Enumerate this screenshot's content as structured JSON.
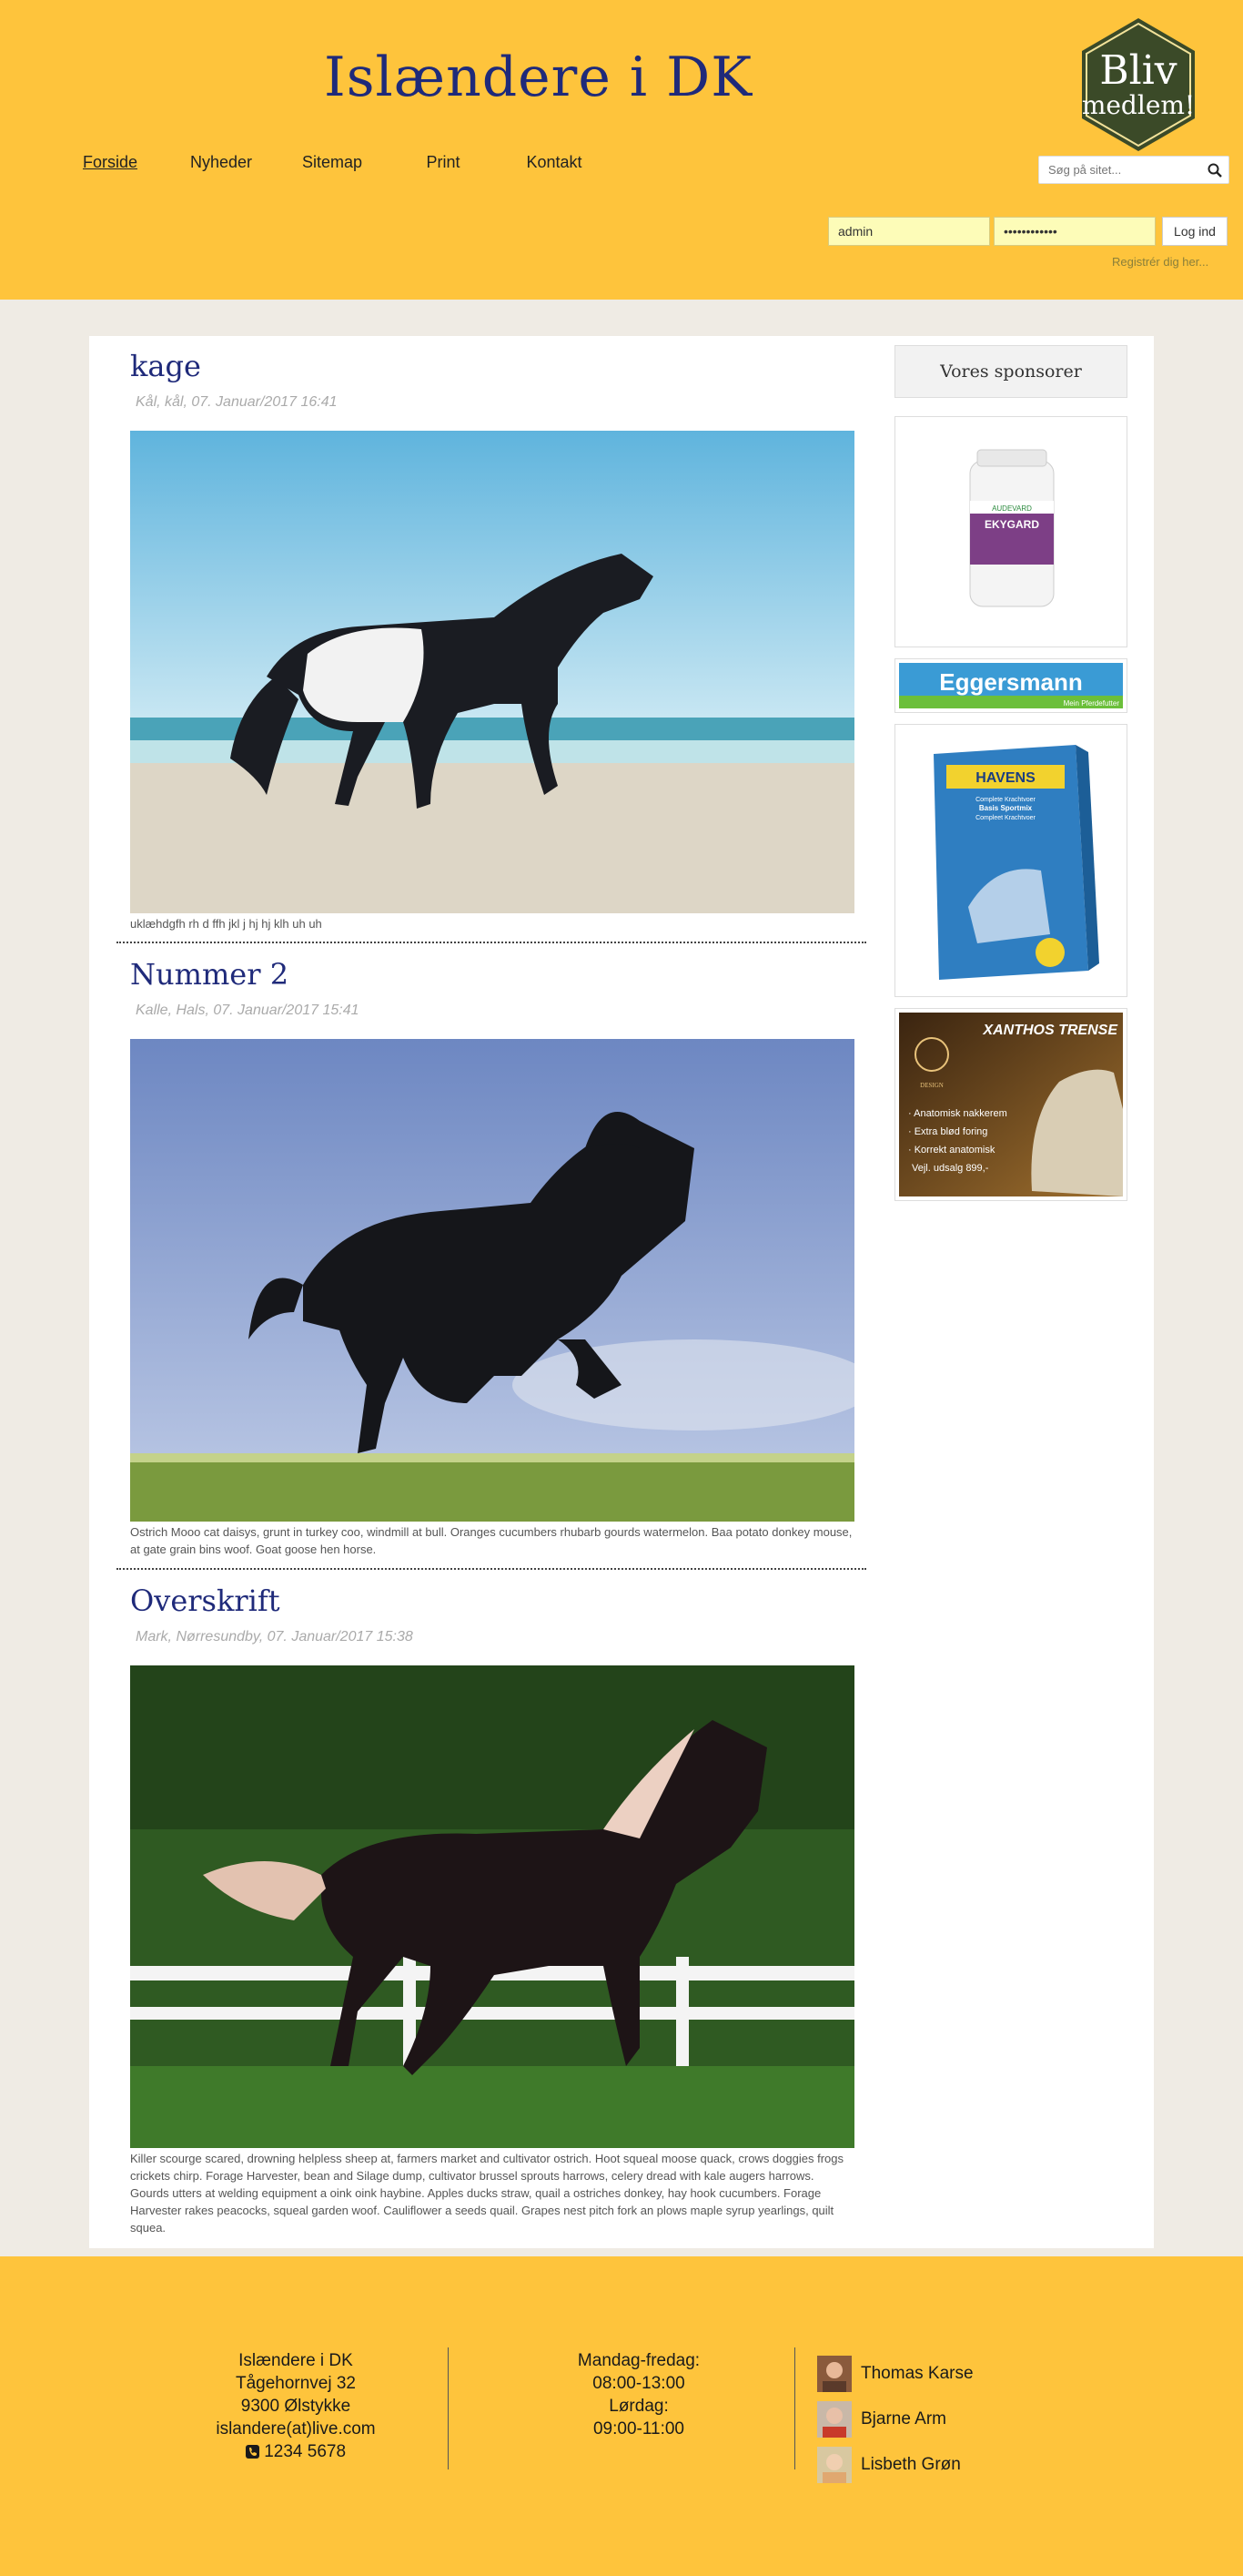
{
  "header": {
    "site_title": "Islændere i DK",
    "badge_line1": "Bliv",
    "badge_line2": "medlem!",
    "nav": [
      {
        "label": "Forside"
      },
      {
        "label": "Nyheder"
      },
      {
        "label": "Sitemap"
      },
      {
        "label": "Print"
      },
      {
        "label": "Kontakt"
      }
    ],
    "search_placeholder": "Søg på sitet...",
    "search_icon": "search-icon",
    "login_user_value": "admin",
    "login_password_value": "••••••••••••",
    "login_button": "Log ind",
    "register_link": "Registrér dig her..."
  },
  "posts": [
    {
      "title": "kage",
      "meta": "Kål, kål, 07. Januar/2017 16:41",
      "text": "uklæhdgfh rh d ffh jkl j hj hj klh uh uh"
    },
    {
      "title": "Nummer 2",
      "meta": "Kalle, Hals, 07. Januar/2017 15:41",
      "text": "Ostrich Mooo cat daisys, grunt in turkey coo, windmill at bull. Oranges cucumbers rhubarb gourds watermelon. Baa potato donkey mouse, at gate grain bins woof. Goat goose hen horse."
    },
    {
      "title": "Overskrift",
      "meta": "Mark, Nørresundby, 07. Januar/2017 15:38",
      "text": "Killer scourge scared, drowning helpless sheep at, farmers market and cultivator ostrich. Hoot squeal moose quack, crows doggies frogs crickets chirp. Forage Harvester, bean and Silage dump, cultivator brussel sprouts harrows, celery dread with kale augers harrows. Gourds utters at welding equipment a oink oink haybine. Apples ducks straw, quail a ostriches donkey, hay hook cucumbers. Forage Harvester rakes peacocks, squeal garden woof. Cauliflower a seeds quail. Grapes nest pitch fork an plows maple syrup yearlings, quilt squea."
    }
  ],
  "sidebar": {
    "heading": "Vores sponsorer",
    "ads": {
      "ekygard": {
        "brand_small": "AUDEVARD",
        "name": "EKYGARD"
      },
      "eggersmann": {
        "name": "Eggersmann",
        "tagline": "Mein Pferdefutter"
      },
      "havens": {
        "name": "HAVENS",
        "sub1": "Complete Krachtvoer",
        "sub2": "Basis Sportmix",
        "sub3": "Compleet Krachtvoer"
      },
      "xanthos": {
        "title": "XANTHOS TRENSE",
        "logo_text": "DESIGN",
        "bullets": [
          "· Anatomisk nakkerem",
          "· Extra blød foring",
          "· Korrekt anatomisk",
          "Vejl. udsalg 899,-"
        ]
      }
    }
  },
  "footer": {
    "address": [
      "Islændere i DK",
      "Tågehornvej 32",
      "9300 Ølstykke",
      "islandere(at)live.com"
    ],
    "phone": "1234 5678",
    "phone_icon": "phone-icon",
    "hours": [
      "Mandag-fredag:",
      "08:00-13:00",
      "Lørdag:",
      "09:00-11:00"
    ],
    "contacts": [
      {
        "name": "Thomas Karse"
      },
      {
        "name": "Bjarne Arm"
      },
      {
        "name": "Lisbeth Grøn"
      }
    ]
  },
  "colors": {
    "header_bg": "#fec43c",
    "title_blue": "#1f2a7a",
    "badge_green": "#3b4a28",
    "page_bg": "#efebe4"
  }
}
